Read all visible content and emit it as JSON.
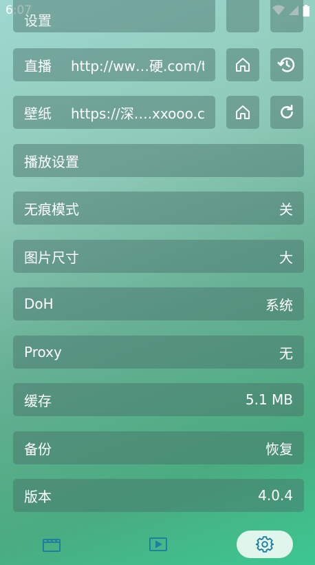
{
  "status_bar": {
    "time": "6:07"
  },
  "partial_row": {
    "label": "设置"
  },
  "live": {
    "label": "直播",
    "url": "http://ww…硬.com/tv"
  },
  "wallpaper": {
    "label": "壁纸",
    "url": "https://深….xxooo.cf/"
  },
  "settings": [
    {
      "label": "播放设置",
      "value": ""
    },
    {
      "label": "无痕模式",
      "value": "关"
    },
    {
      "label": "图片尺寸",
      "value": "大"
    },
    {
      "label": "DoH",
      "value": "系统"
    },
    {
      "label": "Proxy",
      "value": "无"
    },
    {
      "label": "缓存",
      "value": "5.1 MB"
    },
    {
      "label": "备份",
      "value": "恢复"
    },
    {
      "label": "版本",
      "value": "4.0.4"
    }
  ],
  "bottom_nav": {
    "items": [
      {
        "icon": "film-icon"
      },
      {
        "icon": "play-icon"
      },
      {
        "icon": "gear-icon",
        "active": true
      }
    ]
  },
  "colors": {
    "accent": "#1f7fa0",
    "nav_active_bg": "#e0f5ec"
  }
}
